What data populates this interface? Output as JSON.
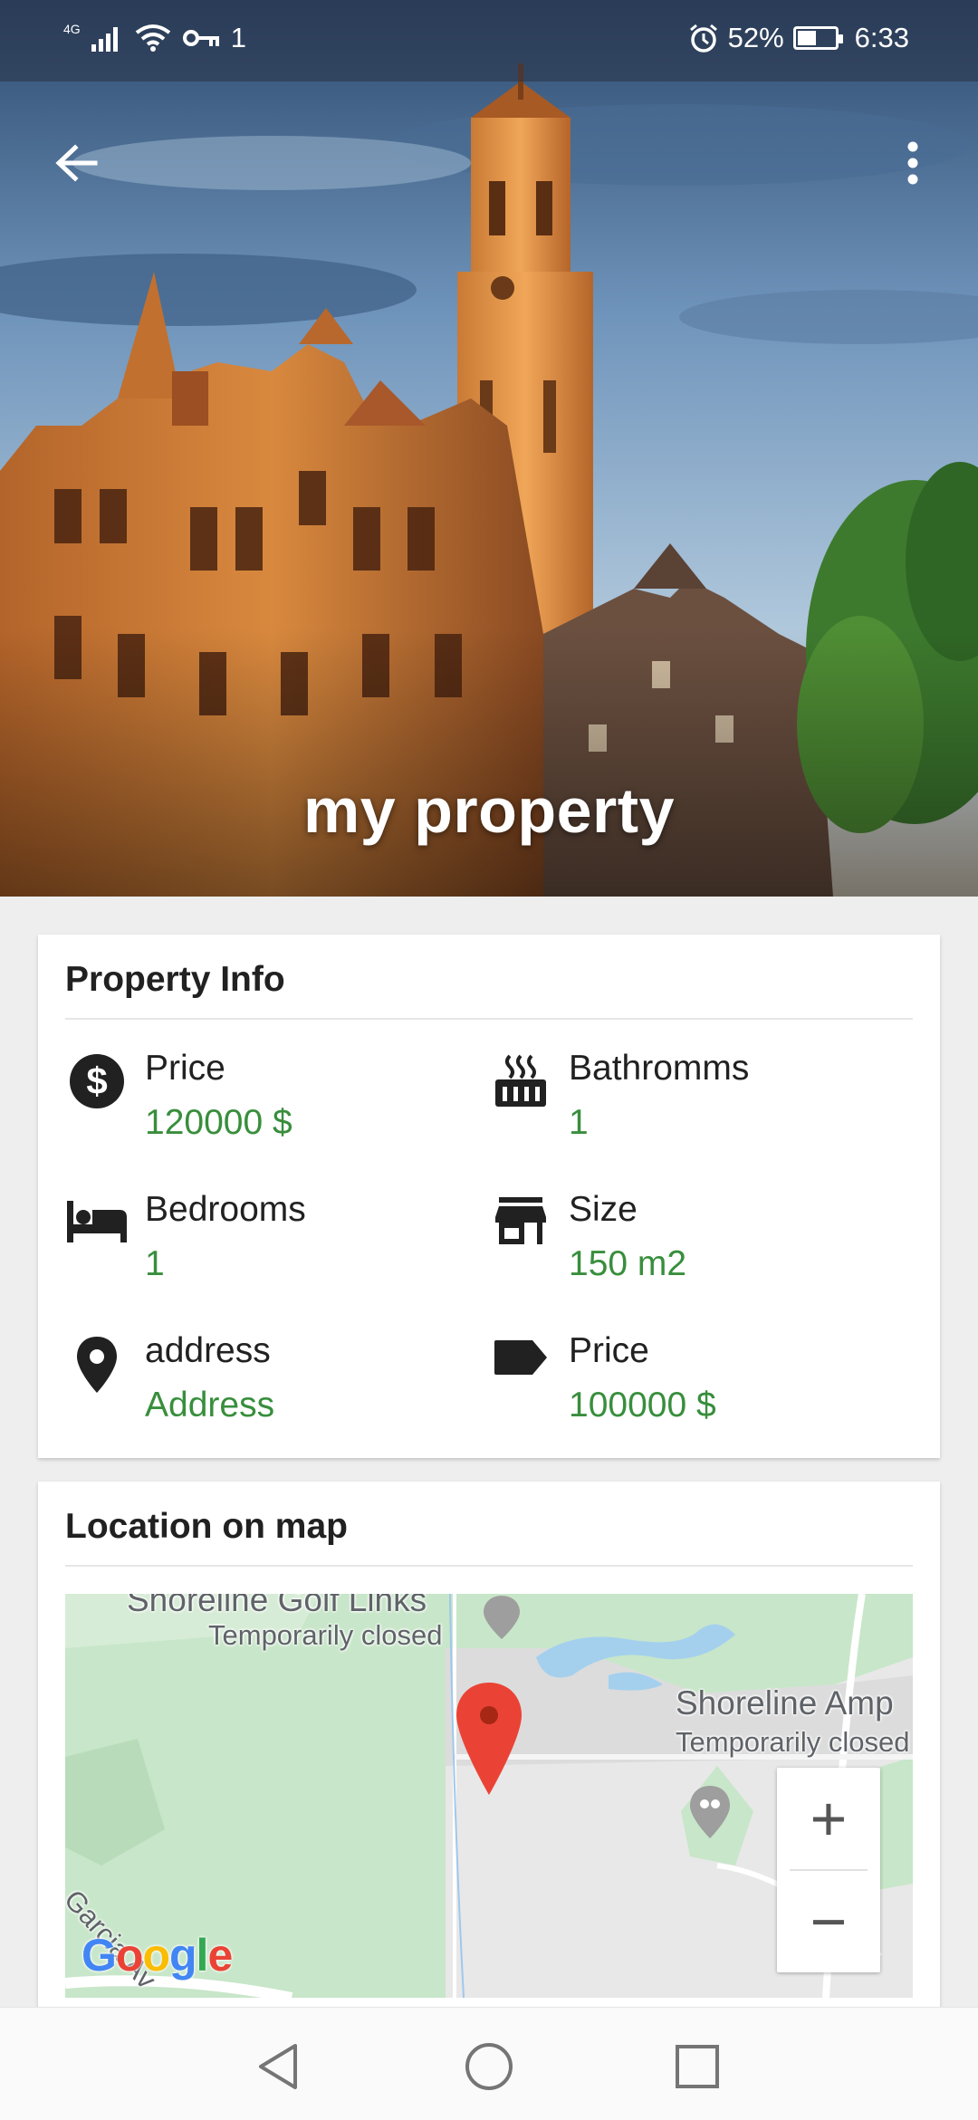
{
  "status_bar": {
    "network_label": "4G",
    "signal_icon": "signal-bars-icon",
    "wifi_icon": "wifi-icon",
    "key_icon": "vpn-key-icon",
    "data_text": "1",
    "alarm_icon": "alarm-clock-icon",
    "battery_percent_text": "52%",
    "battery_level": 0.52,
    "time": "6:33"
  },
  "app_bar": {
    "back_icon": "arrow-back-icon",
    "menu_icon": "more-vert-icon"
  },
  "hero": {
    "title": "my property"
  },
  "property_info": {
    "heading": "Property Info",
    "items": [
      {
        "icon": "dollar-circle-icon",
        "label": "Price",
        "value": "120000 $"
      },
      {
        "icon": "hot-tub-icon",
        "label": "Bathromms",
        "value": "1"
      },
      {
        "icon": "bed-icon",
        "label": "Bedrooms",
        "value": "1"
      },
      {
        "icon": "store-icon",
        "label": "Size",
        "value": "150 m2"
      },
      {
        "icon": "location-pin-icon",
        "label": "address",
        "value": "Address"
      },
      {
        "icon": "label-tag-icon",
        "label": "Price",
        "value": "100000 $"
      }
    ]
  },
  "location": {
    "heading": "Location on map",
    "map": {
      "place1_name": "Shoreline Golf Links",
      "place1_status": "Temporarily closed",
      "place2_name": "Shoreline Amp",
      "place2_status": "Temporarily closed",
      "street_name": "Garcia Av",
      "zoom_in": "+",
      "zoom_out": "−",
      "logo_letters": [
        "G",
        "o",
        "o",
        "g",
        "l",
        "e"
      ],
      "logo_colors": [
        "#4285F4",
        "#EA4335",
        "#FBBC05",
        "#4285F4",
        "#34A853",
        "#EA4335"
      ]
    }
  },
  "nav_bar": {
    "back_icon": "nav-back-triangle-icon",
    "home_icon": "nav-home-circle-icon",
    "recents_icon": "nav-recents-square-icon"
  },
  "colors": {
    "accent_green": "#388e3c",
    "map_pin_red": "#ea4335"
  }
}
